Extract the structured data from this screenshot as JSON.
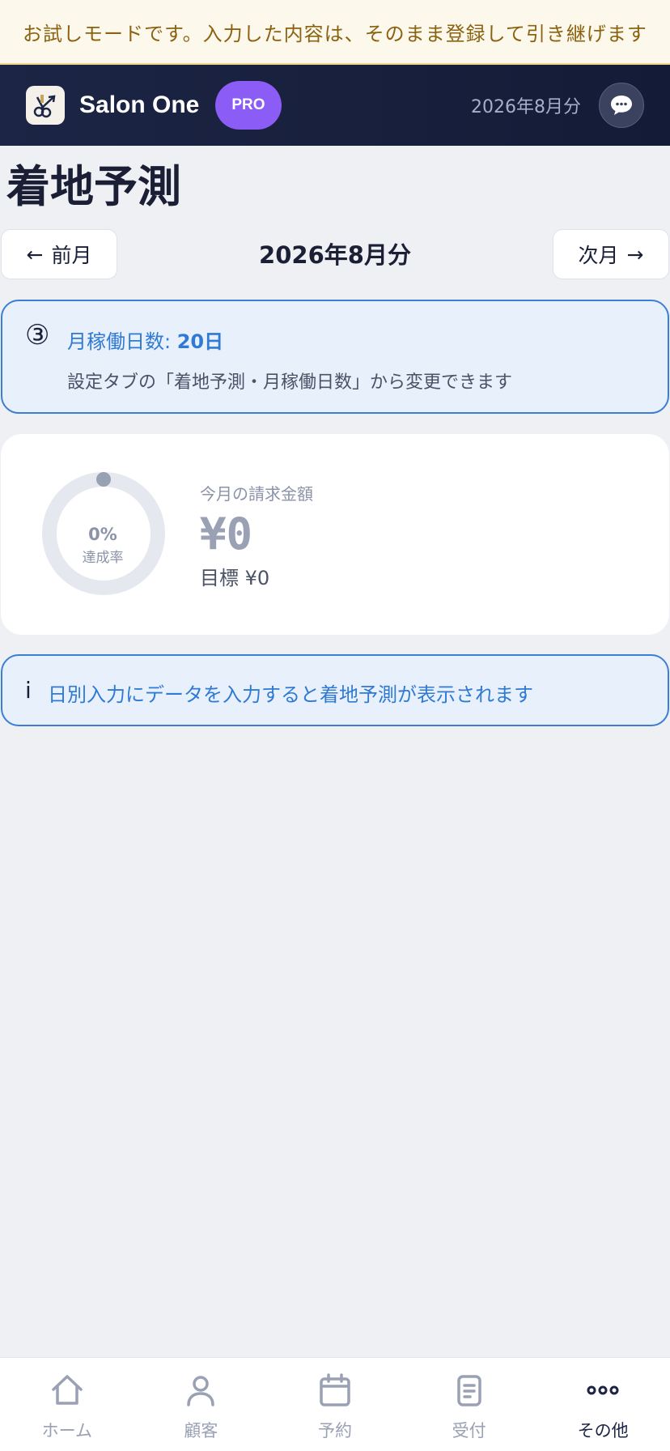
{
  "trial_banner": {
    "text": "お試しモードです。入力した内容は、そのまま登録して引き継げます"
  },
  "header": {
    "app_name": "Salon One",
    "badge": "PRO",
    "month": "2026年8月分",
    "chat_icon": "speech-bubble-icon"
  },
  "page": {
    "title": "着地予測"
  },
  "month_nav": {
    "prev_label": "前月",
    "next_label": "次月",
    "current": "2026年8月分"
  },
  "working_days": {
    "icon": "③",
    "title_prefix": "月稼働日数: ",
    "days": "20日",
    "subtitle": "設定タブの「着地予測・月稼働日数」から変更できます"
  },
  "stats": {
    "achievement_pct": "0%",
    "achievement_value": 0,
    "achievement_label": "達成率",
    "label": "今月の請求金額",
    "amount": "¥0",
    "target": "目標 ¥0"
  },
  "hint": {
    "icon": "i",
    "text": "日別入力にデータを入力すると着地予測が表示されます"
  },
  "tabs": [
    {
      "label": "ホーム",
      "icon": "home-icon",
      "active": false
    },
    {
      "label": "顧客",
      "icon": "person-icon",
      "active": false
    },
    {
      "label": "予約",
      "icon": "calendar-icon",
      "active": false
    },
    {
      "label": "受付",
      "icon": "clipboard-icon",
      "active": false
    },
    {
      "label": "その他",
      "icon": "more-icon",
      "active": true
    }
  ],
  "colors": {
    "accent_blue": "#2f7ad3",
    "pro_purple": "#8b5cf6",
    "header_navy": "#1c2545",
    "banner_text": "#8a6210"
  }
}
